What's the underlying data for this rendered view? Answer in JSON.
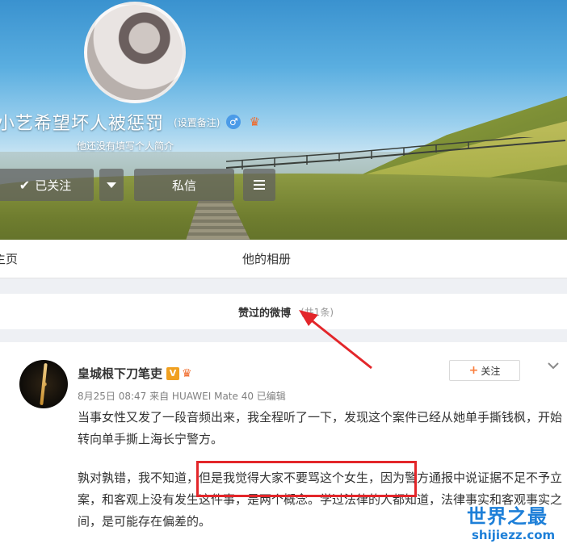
{
  "profile": {
    "nickname": "小艺希望坏人被惩罚",
    "remark": "(设置备注)",
    "bio": "他还没有填写个人简介",
    "gender_icon": "male-icon",
    "badge_icon": "vip-icon"
  },
  "actions": {
    "follow_label": "已关注",
    "message_label": "私信"
  },
  "tabs": {
    "home": "主页",
    "album": "他的相册"
  },
  "liked": {
    "title": "赞过的微博",
    "count": "(共1条)"
  },
  "post": {
    "author": "皇城根下刀笔吏",
    "verified_badge": "V",
    "meta": "8月25日 08:47 来自 HUAWEI Mate 40   已编辑",
    "follow_label": "关注",
    "paragraph1": "当事女性又发了一段音频出来，我全程听了一下，发现这个案件已经从她单手撕钱枫，开始转向单手撕上海长宁警方。",
    "paragraph2": "孰对孰错，我不知道，但是我觉得大家不要骂这个女生，因为警方通报中说证据不足不予立案，和客观上没有发生这件事，是两个概念。学过法律的人都知道，法律事实和客观事实之间，是可能存在偏差的。"
  },
  "annotation": {
    "highlight_color": "#e3262a"
  },
  "watermark": {
    "title": "世界之最",
    "url": "shijiezz.com"
  }
}
